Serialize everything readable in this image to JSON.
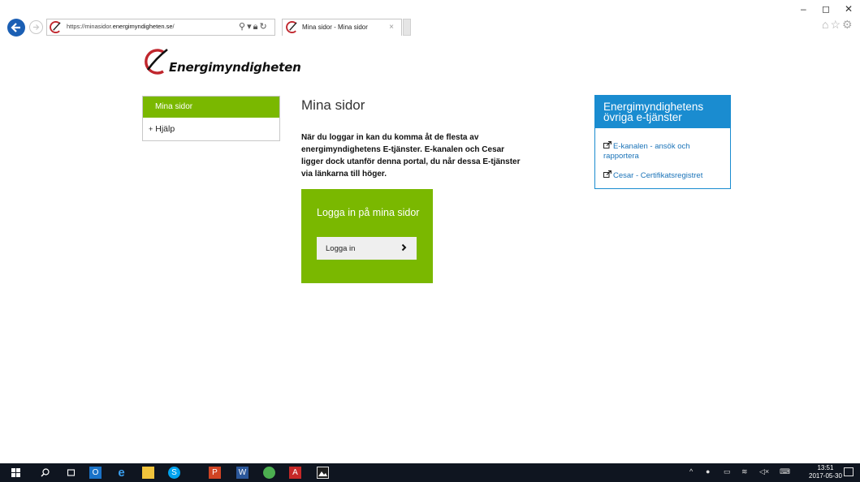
{
  "browser": {
    "url_prefix": "https://minasidor.",
    "url_domain": "energimyndigheten.se",
    "url_suffix": "/",
    "tab_title": "Mina sidor - Mina sidor",
    "tab_close": "×",
    "window_minimize": "–",
    "window_maximize": "◻",
    "window_close": "✕",
    "icons": [
      "back-arrow-icon",
      "forward-arrow-icon",
      "site-favicon",
      "search-icon",
      "lock-icon",
      "refresh-icon",
      "home-icon",
      "favorites-star-icon",
      "settings-gear-icon"
    ]
  },
  "logo": {
    "text": "Energimyndigheten"
  },
  "leftnav": {
    "active": "Mina sidor",
    "items": [
      {
        "prefix": "+",
        "label": "Hjälp"
      }
    ]
  },
  "main": {
    "title": "Mina sidor",
    "description": "När du loggar in kan du komma åt de flesta av energimyndighetens E-tjänster. E-kanalen och Cesar ligger dock utanför denna portal, du når dessa E-tjänster via länkarna till höger."
  },
  "login": {
    "heading": "Logga in på mina sidor",
    "button_label": "Logga in",
    "arrow": "›"
  },
  "services": {
    "heading": "Energimyndighetens övriga e-tjänster",
    "links": [
      {
        "label": "E-kanalen - ansök och rapportera"
      },
      {
        "label": "Cesar - Certifikatsregistret"
      }
    ]
  },
  "taskbar": {
    "time": "13:51",
    "date": "2017-05-30",
    "apps": [
      "windows-start-icon",
      "search-icon",
      "task-view-icon",
      "outlook-icon",
      "internet-explorer-icon",
      "file-explorer-icon",
      "skype-icon",
      "powerpoint-icon",
      "word-icon",
      "chrome-icon",
      "acrobat-icon",
      "photos-icon"
    ],
    "tray_icons": [
      "chevron-up-icon",
      "network-icon",
      "battery-icon",
      "wifi-icon",
      "volume-icon",
      "keyboard-icon",
      "notification-icon"
    ]
  },
  "colors": {
    "green": "#7ab800",
    "blue": "#1a8cd0",
    "link": "#1a73b8",
    "ie_blue": "#1b5fb4"
  }
}
